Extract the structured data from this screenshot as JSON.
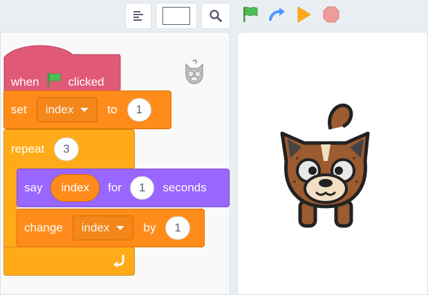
{
  "toolbar": {
    "buttons": [
      {
        "name": "code-view-icon"
      },
      {
        "name": "blank-field"
      },
      {
        "name": "zoom-icon"
      }
    ],
    "green_flag_icon": "green-flag-icon",
    "redo_icon": "redo-arrow-icon",
    "play_icon": "play-icon",
    "stop_icon": "stop-icon"
  },
  "script": {
    "hat": {
      "when": "when",
      "clicked": "clicked"
    },
    "set": {
      "label": "set",
      "variable": "index",
      "to": "to",
      "value": "1"
    },
    "repeat": {
      "label": "repeat",
      "times": "3"
    },
    "say": {
      "label": "say",
      "reporter": "index",
      "for": "for",
      "value": "1",
      "seconds": "seconds"
    },
    "change": {
      "label": "change",
      "variable": "index",
      "by": "by",
      "value": "1"
    }
  },
  "colors": {
    "events": "#e05a78",
    "variables": "#ff8c1a",
    "control": "#ffab19",
    "looks": "#9966ff",
    "flag": "#4cbf56",
    "play": "#ffab19",
    "stop": "#ec9c9c"
  }
}
